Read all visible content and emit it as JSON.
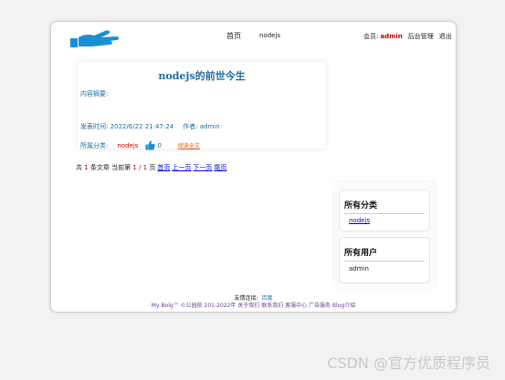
{
  "header": {
    "nav_home": "首页",
    "nav_node": "nodejs",
    "member_label": "会员:",
    "member_name": "admin",
    "admin_link": "后台管理",
    "logout": "退出"
  },
  "article": {
    "title": "nodejs的前世今生",
    "summary": "内容摘要:",
    "time_label": "发表时间: 2022/6/22 21:47:24",
    "author_label": "作者: admin",
    "category_label": "所属分类:",
    "category": "nodejs",
    "likes": "0",
    "read_all": "阅读全文"
  },
  "pager": {
    "prefix": "共",
    "total": "1",
    "mid": "条文章 当前第",
    "current": "1 / 1",
    "page_word": "页",
    "first": "首页",
    "prev": "上一页",
    "next": "下一页",
    "last": "尾页"
  },
  "sidebar": {
    "categories_title": "所有分类",
    "categories": [
      "nodejs"
    ],
    "users_title": "所有用户",
    "users": [
      "admin"
    ]
  },
  "footer": {
    "links_label": "友情连接:",
    "links_item": "百度",
    "copyright": "My Bolg™ ©公园前 201-2022年 关于我们 联系我们 客服中心 广告服务 Blog介绍"
  },
  "watermark": "CSDN @官方优质程序员",
  "colors": {
    "accent": "#1e6fa0",
    "highlight": "#cc0000",
    "logo": "#1a8fd6"
  },
  "icons": {
    "logo": "hand-logo-icon",
    "like": "thumbs-up-icon"
  }
}
